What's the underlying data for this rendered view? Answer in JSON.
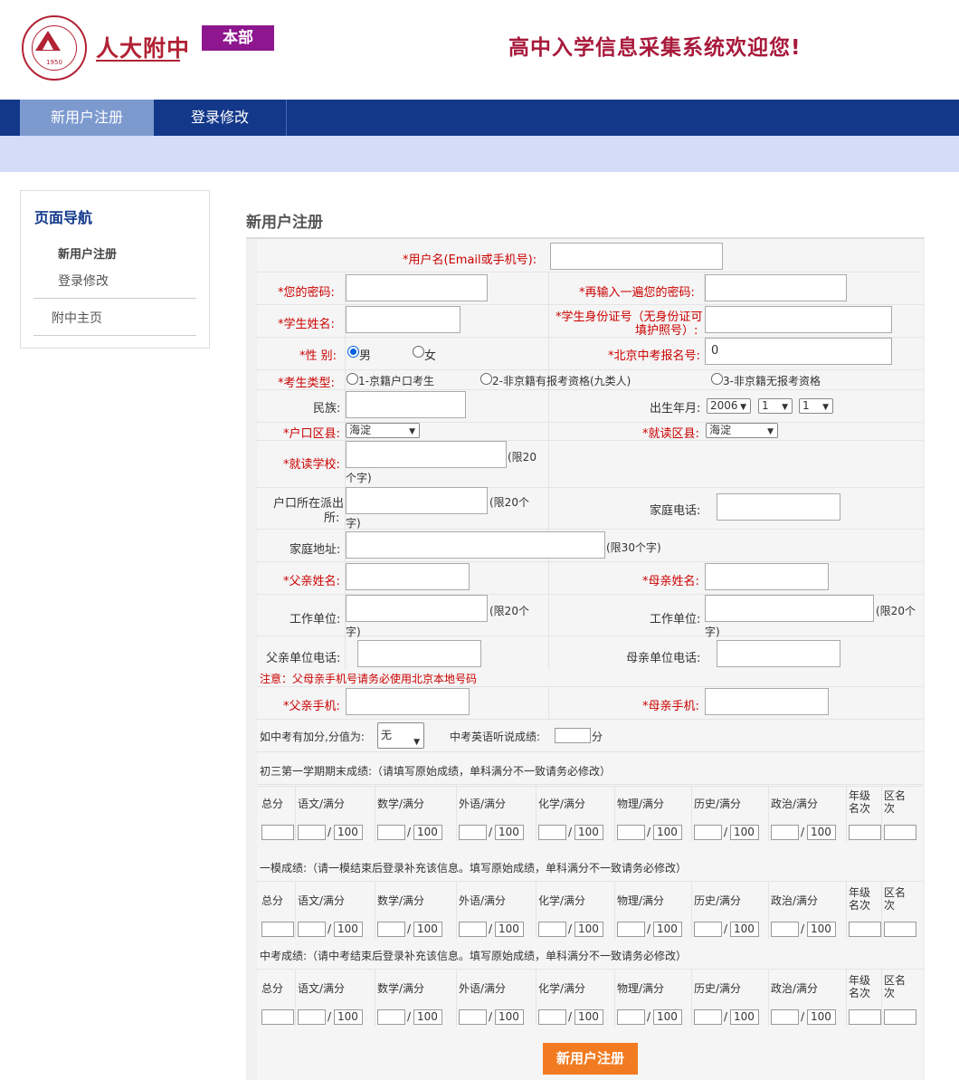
{
  "header": {
    "logo_text": "人大附中",
    "logo_year": "1950",
    "campus_badge": "本部",
    "welcome": "高中入学信息采集系统欢迎您!"
  },
  "nav": {
    "items": [
      {
        "label": "新用户注册",
        "active": true
      },
      {
        "label": "登录修改",
        "active": false
      }
    ]
  },
  "sidebar": {
    "title": "页面导航",
    "links": [
      "新用户注册",
      "登录修改",
      "附中主页"
    ]
  },
  "page_title": "新用户注册",
  "form": {
    "username_label": "*用户名(Email或手机号):",
    "password_label": "*您的密码:",
    "password2_label": "*再输入一遍您的密码:",
    "name_label": "*学生姓名:",
    "idcard_label_1": "*学生身份证号（无身份证可",
    "idcard_label_2": "填护照号）:",
    "gender_label": "*性  别:",
    "gender_male": "男",
    "gender_female": "女",
    "exam_no_label": "*北京中考报名号:",
    "exam_no_value": "0",
    "type_label": "*考生类型:",
    "type_options": [
      "1-京籍户口考生",
      "2-非京籍有报考资格(九类人)",
      "3-非京籍无报考资格"
    ],
    "nation_label": "民族:",
    "birth_label": "出生年月:",
    "birth_year": "2006",
    "birth_month": "1",
    "birth_day": "1",
    "hukou_district_label": "*户口区县:",
    "hukou_district_value": "海淀",
    "school_district_label": "*就读区县:",
    "school_district_value": "海淀",
    "school_label": "*就读学校:",
    "limit20": "(限20",
    "limit20_cont": "个字)",
    "police_label_1": "户口所在派出",
    "police_label_2": "所:",
    "limit20b": "(限20个",
    "limit20b_cont": "字)",
    "home_phone_label": "家庭电话:",
    "address_label": "家庭地址:",
    "limit30": "(限30个字)",
    "father_name_label": "*父亲姓名:",
    "mother_name_label": "*母亲姓名:",
    "work_unit_label": "工作单位:",
    "limit20c": "(限20个",
    "limit20c_cont": "字)",
    "father_phone_label": "父亲单位电话:",
    "mother_phone_label": "母亲单位电话:",
    "notice": "注意：父母亲手机号请务必使用北京本地号码",
    "father_mobile_label": "*父亲手机:",
    "mother_mobile_label": "*母亲手机:",
    "bonus_label": "如中考有加分,分值为:",
    "bonus_value": "无",
    "listening_label": "中考英语听说成绩:",
    "listening_unit": "分"
  },
  "score_sections": [
    {
      "title": "初三第一学期期末成绩:（请填写原始成绩，单科满分不一致请务必修改）",
      "headers": [
        "总分",
        "语文/满分",
        "数学/满分",
        "外语/满分",
        "化学/满分",
        "物理/满分",
        "历史/满分",
        "政治/满分",
        "年级名次",
        "区名次"
      ]
    },
    {
      "title": "一模成绩:（请一模结束后登录补充该信息。填写原始成绩，单科满分不一致请务必修改）",
      "headers": [
        "总分",
        "语文/满分",
        "数学/满分",
        "外语/满分",
        "化学/满分",
        "物理/满分",
        "历史/满分",
        "政治/满分",
        "年级名次",
        "区名次"
      ]
    },
    {
      "title": "中考成绩:（请中考结束后登录补充该信息。填写原始成绩，单科满分不一致请务必修改）",
      "headers": [
        "总分",
        "语文/满分",
        "数学/满分",
        "外语/满分",
        "化学/满分",
        "物理/满分",
        "历史/满分",
        "政治/满分",
        "年级名次",
        "区名次"
      ]
    }
  ],
  "full_mark": "100",
  "submit_label": "新用户注册"
}
